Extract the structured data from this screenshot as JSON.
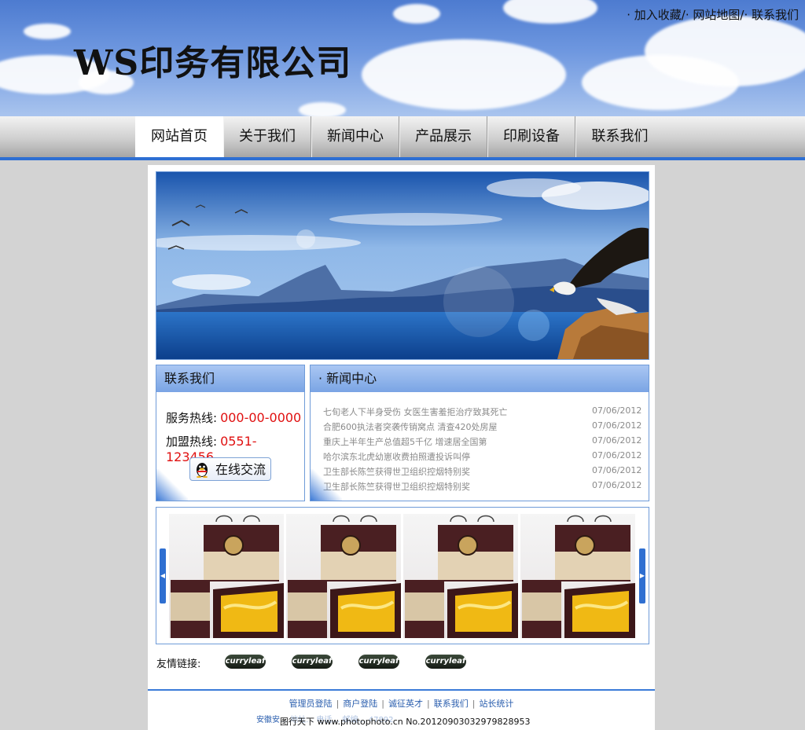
{
  "header": {
    "site_title": "WS印务有限公司",
    "top_links": [
      "· 加入收藏/",
      "· 网站地图/",
      "· 联系我们"
    ]
  },
  "nav": {
    "items": [
      "网站首页",
      "关于我们",
      "新闻中心",
      "产品展示",
      "印刷设备",
      "联系我们"
    ],
    "active_index": 0
  },
  "contact": {
    "title": "联系我们",
    "service_label": "服务热线:",
    "service_number": "000-00-0000",
    "franchise_label": "加盟热线:",
    "franchise_number": "0551-123456",
    "chat_button": "在线交流"
  },
  "news": {
    "title": "· 新闻中心",
    "items": [
      {
        "title": "七旬老人下半身受伤 女医生害羞拒治疗致其死亡",
        "date": "07/06/2012"
      },
      {
        "title": "合肥600执法者突袭传销窝点 清查420处房屋",
        "date": "07/06/2012"
      },
      {
        "title": "重庆上半年生产总值超5千亿 增速居全国第",
        "date": "07/06/2012"
      },
      {
        "title": "哈尔滨东北虎幼崽收费拍照遭投诉叫停",
        "date": "07/06/2012"
      },
      {
        "title": "卫生部长陈竺获得世卫组织控烟特别奖",
        "date": "07/06/2012"
      },
      {
        "title": "卫生部长陈竺获得世卫组织控烟特别奖",
        "date": "07/06/2012"
      }
    ]
  },
  "friend_links": {
    "label": "友情链接:",
    "items": [
      "curryleaf",
      "curryleaf",
      "curryleaf",
      "curryleaf"
    ]
  },
  "footer": {
    "links": [
      "管理员登陆",
      "商户登陆",
      "诚征英才",
      "联系我们",
      "站长统计"
    ],
    "info": "安徽安… 地址… 电话… 邮编… 47892"
  },
  "watermark": "图行天下 www.photophoto.cn  No.20120903032979828953",
  "colors": {
    "nav_underline": "#2d6fd3",
    "hotline_number": "#e01010",
    "panel_border": "#6f9bd8"
  },
  "icons": [
    "qq-penguin-icon",
    "left-arrow-icon",
    "right-arrow-icon"
  ]
}
